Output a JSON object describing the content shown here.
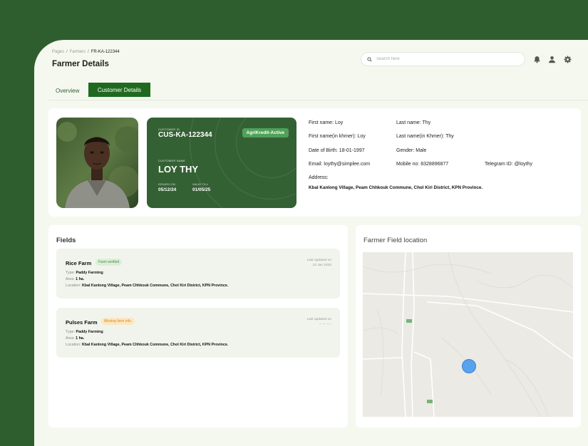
{
  "breadcrumb": {
    "root": "Pages",
    "section": "Farmers",
    "current": "FR-KA-122344"
  },
  "page_title": "Farmer Details",
  "search": {
    "placeholder": "Search here",
    "value": ""
  },
  "header_icons": [
    "bell-icon",
    "user-icon",
    "gear-icon"
  ],
  "tabs": [
    {
      "label": "Overview",
      "active": false
    },
    {
      "label": "Customer Details",
      "active": true
    }
  ],
  "id_card": {
    "customer_id_label": "CUSTOMER ID",
    "customer_id": "CUS-KA-122344",
    "status_badge": "AgriKredit-Active",
    "customer_name_label": "CUSTOMER NAME",
    "customer_name": "LOY THY",
    "issued_label": "ISSUED ON",
    "issued_on": "05/12/24",
    "valid_label": "VALID TILL",
    "valid_till": "01/05/25"
  },
  "info": {
    "first_name": "First name: Loy",
    "last_name": "Last name: Thy",
    "first_name_khmer": "First name(in khmer): Loy",
    "last_name_khmer": "Last name(in Khmer): Thy",
    "dob": "Date of Birth: 18-01-1997",
    "gender": "Gender: Male",
    "email": "Email: loythy@simplee.com",
    "mobile": "Mobile no: 8328896877",
    "telegram": "Telegram ID: @loythy",
    "address_label": "Address:",
    "address": "Kbal Kanlong Village, Peam Chhkouk Commune, Chol Kiri District, KPN Province."
  },
  "fields": {
    "title": "Fields",
    "farms": [
      {
        "name": "Rice Farm",
        "badge": "Farm verified",
        "updated_label": "Last updated on",
        "updated_date": "12 Jan 2025",
        "type_label": "Type:",
        "type": "Paddy Farming",
        "area_label": "Area:",
        "area": "1 ha.",
        "location_label": "Location:",
        "location": "Kbal Kanlong Village, Peam Chhkouk Commune, Chol Kiri District, KPN Province."
      },
      {
        "name": "Pulses Farm",
        "badge": "Missing farm info.",
        "updated_label": "Last updated on",
        "updated_date": "-- --- ----",
        "type_label": "Type:",
        "type": "Paddy Farming",
        "area_label": "Area:",
        "area": "1 ha.",
        "location_label": "Location:",
        "location": "Kbal Kanlong Village, Peam Chhkouk Commune, Chol Kiri District, KPN Province."
      }
    ]
  },
  "map": {
    "title": "Farmer Field location"
  },
  "colors": {
    "brand": "#2f5e2e",
    "active_tab": "#1f6a1f",
    "card": "#346134",
    "pin": "#5aa2ee"
  }
}
